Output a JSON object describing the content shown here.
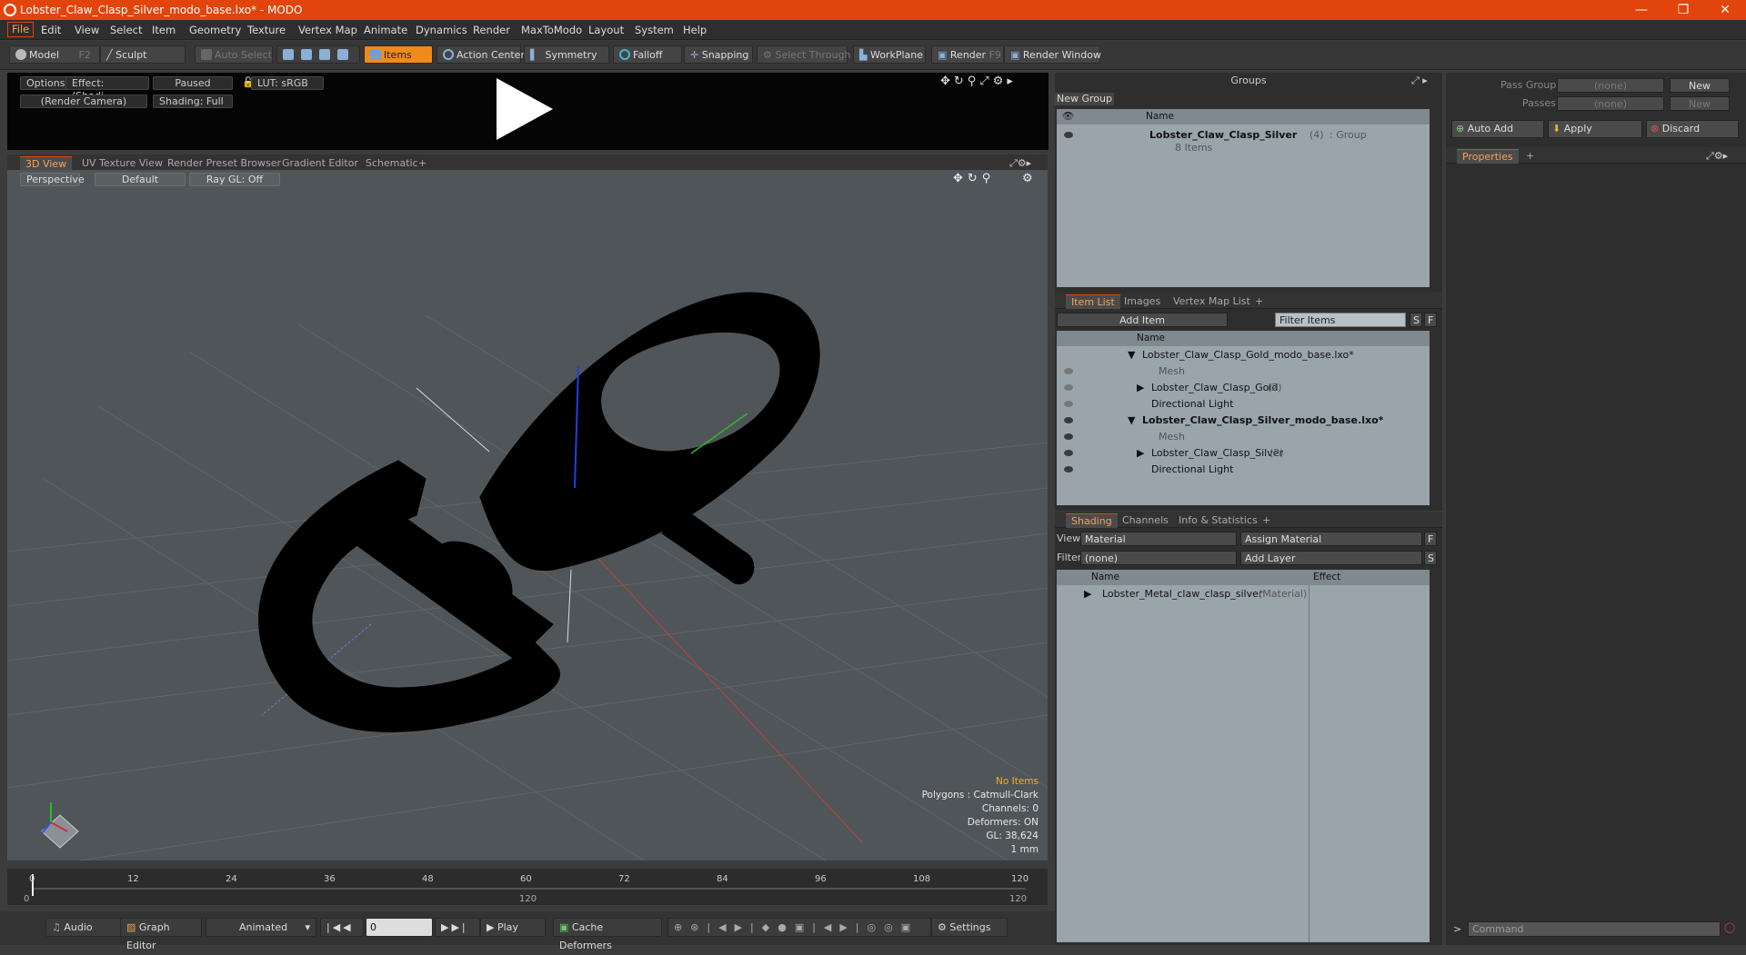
{
  "window": {
    "title": "Lobster_Claw_Clasp_Silver_modo_base.lxo* - MODO",
    "minimize": "—",
    "maximize": "❐",
    "close": "✕"
  },
  "menu": [
    "File",
    "Edit",
    "View",
    "Select",
    "Item",
    "Geometry",
    "Texture",
    "Vertex Map",
    "Animate",
    "Dynamics",
    "Render",
    "MaxToModo",
    "Layout",
    "System",
    "Help"
  ],
  "toolbar": {
    "model": "Model",
    "model_key": "F2",
    "sculpt": "Sculpt",
    "auto_select": "Auto Select",
    "items": "Items",
    "action_center": "Action Center",
    "symmetry": "Symmetry",
    "falloff": "Falloff",
    "snapping": "Snapping",
    "select_through": "Select Through",
    "workplane": "WorkPlane",
    "render": "Render",
    "render_key": "F9",
    "render_window": "Render Window"
  },
  "preview": {
    "options": "Options",
    "effect": "Effect: (Shadi...",
    "paused": "Paused",
    "lut": "LUT: sRGB",
    "camera": "(Render Camera)",
    "shading": "Shading: Full"
  },
  "viewtabs": [
    "3D View",
    "UV Texture View",
    "Render Preset Browser",
    "Gradient Editor",
    "Schematic",
    "+"
  ],
  "viewport": {
    "perspective": "Perspective",
    "default": "Default",
    "raygl": "Ray GL: Off",
    "info": {
      "items": "No Items",
      "polygons": "Polygons : Catmull-Clark",
      "channels": "Channels: 0",
      "deformers": "Deformers: ON",
      "gl": "GL: 38,624",
      "scale": "1 mm"
    }
  },
  "timeline": {
    "ticks": [
      "0",
      "12",
      "24",
      "36",
      "48",
      "60",
      "72",
      "84",
      "96",
      "108",
      "120"
    ],
    "start": "0",
    "mid": "120",
    "end": "120"
  },
  "bottom": {
    "audio": "Audio",
    "graph_editor": "Graph Editor",
    "animated": "Animated",
    "frame": "0",
    "play": "Play",
    "cache": "Cache Deformers",
    "settings": "Settings"
  },
  "groups": {
    "title": "Groups",
    "new_group": "New Group",
    "name_col": "Name",
    "group_name": "Lobster_Claw_Clasp_Silver",
    "group_count": "(4)",
    "group_type": ": Group",
    "group_items": "8 Items"
  },
  "itemlist": {
    "tabs": [
      "Item List",
      "Images",
      "Vertex Map List",
      "+"
    ],
    "add_item": "Add Item",
    "filter": "Filter Items",
    "s": "S",
    "f": "F",
    "name_col": "Name",
    "rows": [
      {
        "label": "Lobster_Claw_Clasp_Gold_modo_base.lxo*",
        "bold": false
      },
      {
        "label": "Mesh",
        "dim": true
      },
      {
        "label": "Lobster_Claw_Clasp_Gold",
        "count": "(2)"
      },
      {
        "label": "Directional Light"
      },
      {
        "label": "Lobster_Claw_Clasp_Silver_modo_base.lxo*",
        "bold": true
      },
      {
        "label": "Mesh",
        "dim": true
      },
      {
        "label": "Lobster_Claw_Clasp_Silver",
        "count": "(2)"
      },
      {
        "label": "Directional Light"
      }
    ]
  },
  "shading": {
    "tabs": [
      "Shading",
      "Channels",
      "Info & Statistics",
      "+"
    ],
    "view_label": "View",
    "view_value": "Material",
    "assign": "Assign Material",
    "filter_label": "Filter",
    "filter_value": "(none)",
    "add_layer": "Add Layer",
    "f": "F",
    "s": "S",
    "name_col": "Name",
    "effect_col": "Effect",
    "material": "Lobster_Metal_claw_clasp_silver",
    "material_type": "(Material)"
  },
  "right": {
    "pass_groups": "Pass Groups",
    "passes": "Passes",
    "none": "(none)",
    "new": "New",
    "auto_add": "Auto Add",
    "apply": "Apply",
    "discard": "Discard",
    "properties": "Properties",
    "command": "Command"
  }
}
